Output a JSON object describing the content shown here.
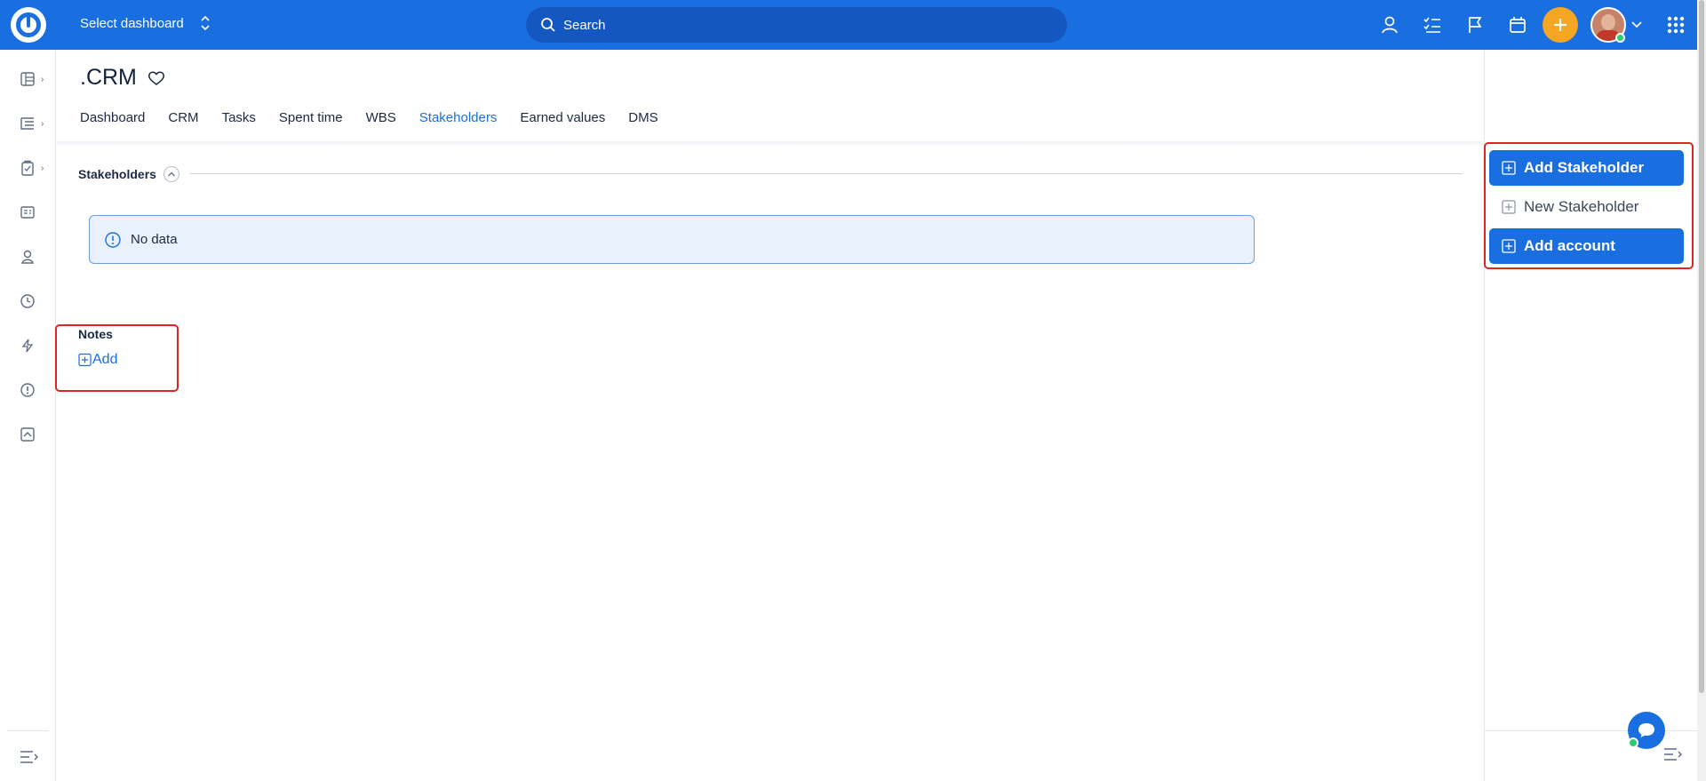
{
  "topbar": {
    "dashboard_select": "Select dashboard",
    "search_placeholder": "Search"
  },
  "project": {
    "title": ".CRM"
  },
  "tabs": [
    {
      "label": "Dashboard"
    },
    {
      "label": "CRM"
    },
    {
      "label": "Tasks"
    },
    {
      "label": "Spent time"
    },
    {
      "label": "WBS"
    },
    {
      "label": "Stakeholders",
      "active": true
    },
    {
      "label": "Earned values"
    },
    {
      "label": "DMS"
    }
  ],
  "stakeholders": {
    "heading": "Stakeholders",
    "empty_message": "No data"
  },
  "notes": {
    "heading": "Notes",
    "add_label": "Add"
  },
  "sidebar_actions": {
    "add_stakeholder": "Add Stakeholder",
    "new_stakeholder": "New Stakeholder",
    "add_account": "Add account"
  },
  "colors": {
    "brand": "#1a6fe0",
    "accent": "#f5a623",
    "highlight": "#e02424"
  }
}
